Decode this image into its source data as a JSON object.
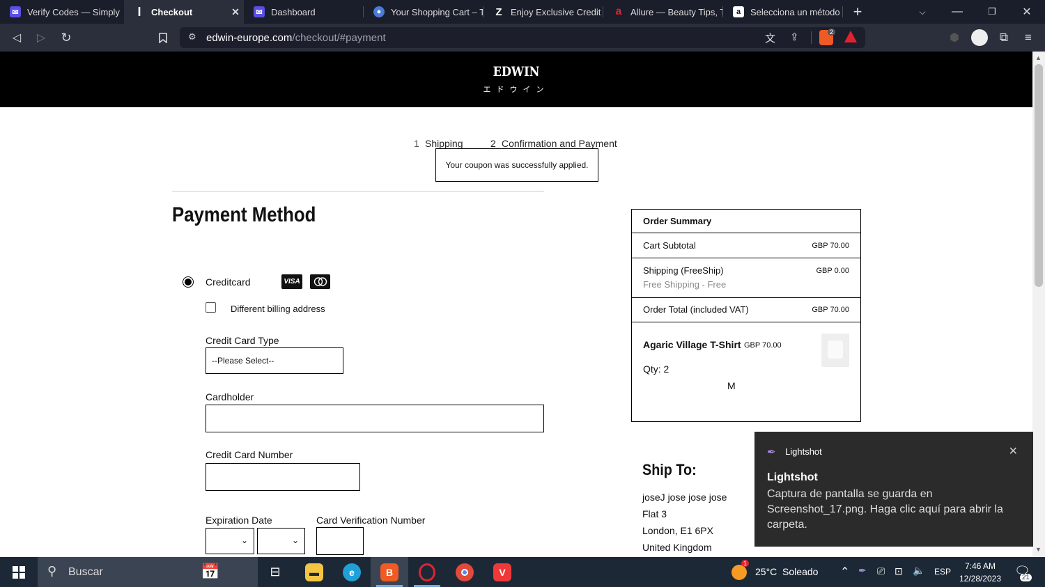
{
  "browser": {
    "tabs": [
      {
        "title": "Verify Codes — Simply",
        "favicon": "V",
        "color": "#5b4ee6"
      },
      {
        "title": "Checkout",
        "favicon": "I",
        "color": "#ffffff",
        "active": true
      },
      {
        "title": "Dashboard",
        "favicon": "V",
        "color": "#5b4ee6"
      },
      {
        "title": "Your Shopping Cart – T",
        "favicon": "globe",
        "color": "#4a7bd6"
      },
      {
        "title": "Enjoy Exclusive Credit C",
        "favicon": "Z",
        "color": "#ffffff"
      },
      {
        "title": "Allure — Beauty Tips, T",
        "favicon": "a",
        "color": "#e0242f"
      },
      {
        "title": "Selecciona un método",
        "favicon": "a",
        "color": "#f5a623"
      }
    ],
    "url_host": "edwin-europe.com",
    "url_path": "/checkout/#payment",
    "brave_badge": "2"
  },
  "header": {
    "brand": "EDWIN",
    "brand_sub": "エドウイン"
  },
  "steps": {
    "step1_num": "1",
    "step1_label": "Shipping",
    "step2_num": "2",
    "step2_label": "Confirmation and Payment"
  },
  "coupon_message": "Your coupon was successfully applied.",
  "payment": {
    "title": "Payment Method",
    "method_label": "Creditcard",
    "visa": "VISA",
    "mastercard": "mastercard",
    "billing_label": "Different billing address",
    "card_type_label": "Credit Card Type",
    "card_type_value": "--Please Select--",
    "cardholder_label": "Cardholder",
    "card_number_label": "Credit Card Number",
    "expiration_label": "Expiration Date",
    "cvv_label": "Card Verification Number"
  },
  "summary": {
    "title": "Order Summary",
    "subtotal_label": "Cart Subtotal",
    "subtotal_value": "GBP 70.00",
    "shipping_label": "Shipping (FreeShip)",
    "shipping_value": "GBP 0.00",
    "shipping_sub": "Free Shipping - Free",
    "total_label": "Order Total (included VAT)",
    "total_value": "GBP 70.00",
    "item_name": "Agaric Village T-Shirt",
    "item_price": "GBP 70.00",
    "item_qty": "Qty: 2",
    "item_size": "M"
  },
  "ship_to": {
    "title": "Ship To:",
    "lines": [
      "joseJ jose jose jose",
      "Flat 3",
      "London, E1 6PX",
      "United Kingdom"
    ]
  },
  "toast": {
    "app": "Lightshot",
    "title": "Lightshot",
    "body": "Captura de pantalla se guarda en Screenshot_17.png. Haga clic aquí para abrir la carpeta."
  },
  "taskbar": {
    "search_placeholder": "Buscar",
    "weather": "25°C  Soleado",
    "weather_badge": "1",
    "lang": "ESP",
    "time": "7:46 AM",
    "date": "12/28/2023",
    "notif_count": "21"
  }
}
